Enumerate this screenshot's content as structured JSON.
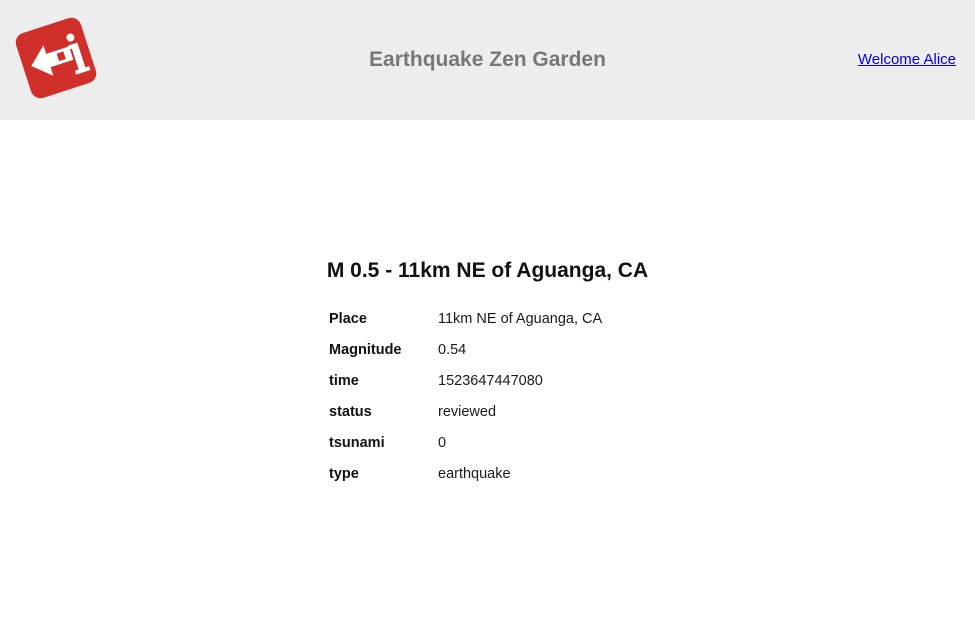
{
  "header": {
    "logo_icon": "red-arrow-logo-icon",
    "title": "Earthquake Zen Garden",
    "welcome_link": "Welcome Alice"
  },
  "earthquake": {
    "title": "M 0.5 - 11km NE of Aguanga, CA",
    "rows": [
      {
        "label": "Place",
        "value": "11km NE of Aguanga, CA"
      },
      {
        "label": "Magnitude",
        "value": "0.54"
      },
      {
        "label": "time",
        "value": "1523647447080"
      },
      {
        "label": "status",
        "value": "reviewed"
      },
      {
        "label": "tsunami",
        "value": "0"
      },
      {
        "label": "type",
        "value": "earthquake"
      }
    ]
  },
  "colors": {
    "header_bg": "#ededed",
    "logo_red": "#d12f2a",
    "title_gray": "#777777",
    "link_blue": "#0000ee"
  }
}
